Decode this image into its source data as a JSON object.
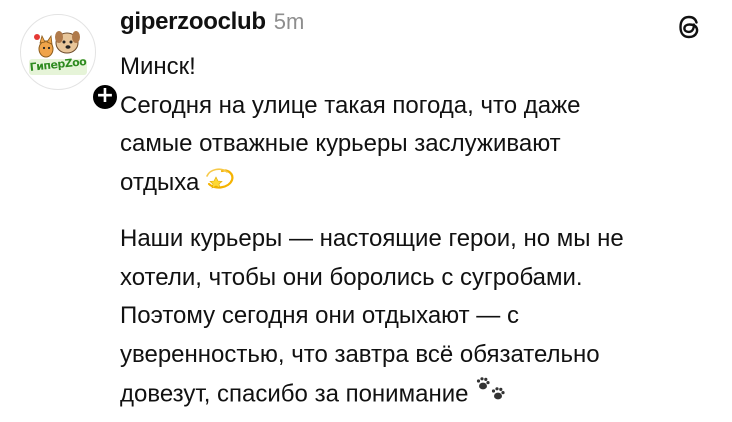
{
  "post": {
    "username": "giperzooclub",
    "timestamp": "5m",
    "avatar_logo_text": "ГиперZoo",
    "follow_badge": "+",
    "paragraphs": [
      {
        "lines": [
          "Минск!"
        ]
      },
      {
        "lines": [
          "Сегодня на улице такая погода, что даже",
          "самые отважные курьеры заслуживают",
          "отдыха"
        ],
        "emoji": "dizzy-star"
      },
      {
        "lines": [
          "Наши курьеры — настоящие герои, но мы не",
          "хотели, чтобы они боролись с сугробами.",
          "Поэтому сегодня они отдыхают — с",
          "уверенностью, что завтра всё обязательно",
          "довезут, спасибо за понимание"
        ],
        "emoji": "paw-prints"
      }
    ]
  },
  "icons": {
    "threads": "threads-logo-icon",
    "follow": "plus-icon",
    "emoji_1": "dizzy-icon",
    "emoji_2": "paw-prints-icon"
  },
  "colors": {
    "text": "#111111",
    "timestamp": "#8e8e8e",
    "logo_green": "#2e8b1e",
    "badge": "#000000"
  }
}
